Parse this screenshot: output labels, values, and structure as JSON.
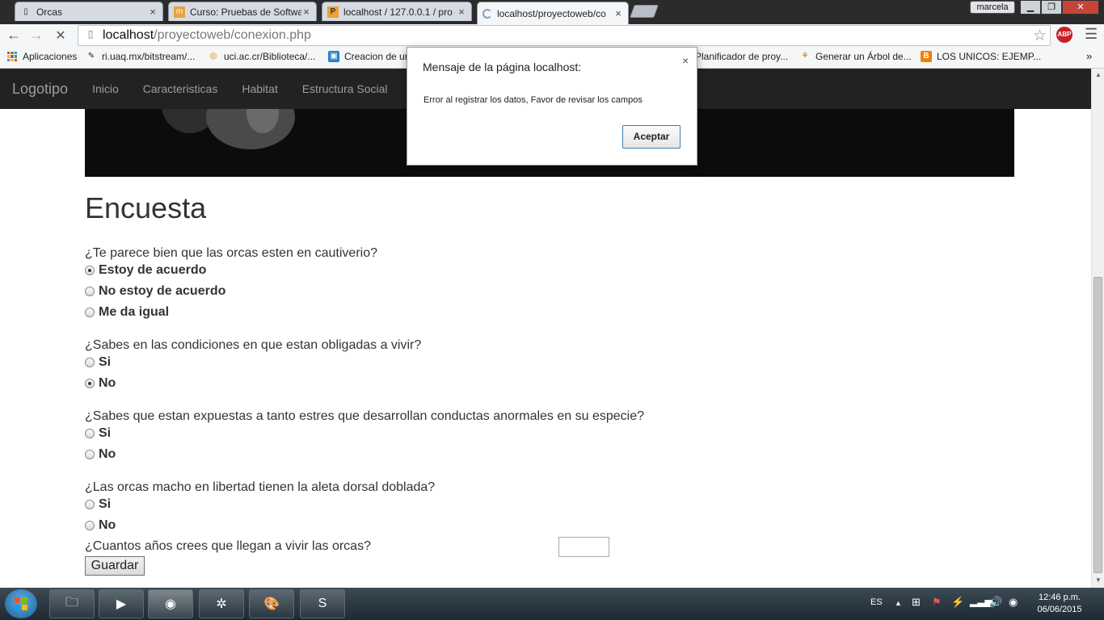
{
  "tabs": [
    {
      "title": "Orcas",
      "icon": "page-icon"
    },
    {
      "title": "Curso: Pruebas de Softwa",
      "icon": "moodle-icon"
    },
    {
      "title": "localhost / 127.0.0.1 / pro",
      "icon": "phpmyadmin-icon"
    },
    {
      "title": "localhost/proyectoweb/co",
      "icon": "loading-spinner-icon"
    }
  ],
  "window": {
    "user": "marcela",
    "minimize": "▁",
    "maximize": "❐",
    "close": "✕"
  },
  "address": {
    "host": "localhost",
    "path": "/proyectoweb/conexion.php"
  },
  "toolbar": {
    "abp": "ABP"
  },
  "bookmarks": [
    {
      "label": "Aplicaciones",
      "icon": "apps-icon"
    },
    {
      "label": "ri.uaq.mx/bitstream/...",
      "icon": "bitstream-icon"
    },
    {
      "label": "uci.ac.cr/Biblioteca/...",
      "icon": "uci-icon"
    },
    {
      "label": "Creacion de ur",
      "icon": "creately-icon"
    },
    {
      "label": "Planificador de proy...",
      "icon": "planner-icon"
    },
    {
      "label": "Generar un Árbol de...",
      "icon": "tree-icon"
    },
    {
      "label": "LOS UNICOS: EJEMP...",
      "icon": "blogger-icon"
    }
  ],
  "site": {
    "brand": "Logotipo",
    "nav": [
      "Inicio",
      "Caracteristicas",
      "Habitat",
      "Estructura Social"
    ],
    "heading": "Encuesta",
    "questions": [
      {
        "text": "¿Te parece bien que las orcas esten en cautiverio?",
        "options": [
          {
            "label": "Estoy de acuerdo",
            "checked": true
          },
          {
            "label": "No estoy de acuerdo",
            "checked": false
          },
          {
            "label": "Me da igual",
            "checked": false
          }
        ]
      },
      {
        "text": "¿Sabes en las condiciones en que estan obligadas a vivir?",
        "options": [
          {
            "label": "Si",
            "checked": false
          },
          {
            "label": "No",
            "checked": true
          }
        ]
      },
      {
        "text": "¿Sabes que estan expuestas a tanto estres que desarrollan conductas anormales en su especie?",
        "options": [
          {
            "label": "Si",
            "checked": false
          },
          {
            "label": "No",
            "checked": false
          }
        ]
      },
      {
        "text": "¿Las orcas macho en libertad tienen la aleta dorsal doblada?",
        "options": [
          {
            "label": "Si",
            "checked": false
          },
          {
            "label": "No",
            "checked": false
          }
        ]
      }
    ],
    "age_question": "¿Cuantos años crees que llegan a vivir las orcas?",
    "age_value": "",
    "save_label": "Guardar"
  },
  "dialog": {
    "title": "Mensaje de la página localhost:",
    "message": "Error al registrar los datos, Favor de revisar los campos",
    "ok": "Aceptar",
    "close": "×"
  },
  "taskbar": {
    "apps": [
      "file-explorer-icon",
      "media-player-icon",
      "chrome-icon",
      "xampp-icon",
      "paint-icon",
      "sublime-text-icon"
    ],
    "apps_glyphs": [
      "🗀",
      "▶",
      "◉",
      "✲",
      "🎨",
      "S"
    ],
    "lang": "ES",
    "time": "12:46 p.m.",
    "date": "06/06/2015"
  }
}
